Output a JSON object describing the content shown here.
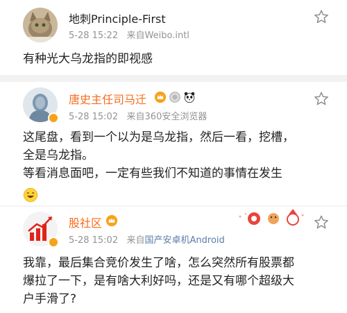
{
  "posts": [
    {
      "author": "地刺Principle-First",
      "time": "5-28 15:22",
      "source_prefix": "来自",
      "source": "Weibo.intl",
      "text_lines": [
        "有种光大乌龙指的即视感"
      ]
    },
    {
      "author": "唐史主任司马迁",
      "time": "5-28 15:02",
      "source_prefix": "来自",
      "source": "360安全浏览器",
      "text_lines": [
        "这尾盘，看到一个以为是乌龙指，然后一看，挖槽，",
        "全是乌龙指。",
        "等看消息面吧，一定有些我们不知道的事情在发生"
      ]
    },
    {
      "author": "股社区",
      "time": "5-28 15:02",
      "source_prefix": "来自",
      "source": "国产安卓机Android",
      "text_lines": [
        "我靠，最后集合竞价发生了啥，怎么突然所有股票都",
        "爆拉了一下，是有啥大利好吗，还是又有哪个超级大",
        "户手滑了?"
      ]
    }
  ],
  "colors": {
    "vip_name": "#f86b1c",
    "normal_name": "#222222",
    "meta": "#939393",
    "source_link": "#5b7ea8",
    "divider": "#f2f2f2"
  },
  "icons": [
    "star-icon",
    "vip-crown-icon",
    "verified-badge-icon",
    "laugh-emoji-icon"
  ]
}
